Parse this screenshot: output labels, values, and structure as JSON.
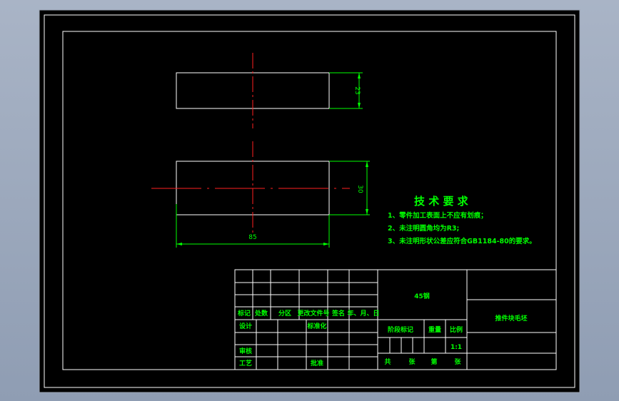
{
  "dimensions": {
    "top_height": "23",
    "front_height": "30",
    "length": "85"
  },
  "tech_requirements": {
    "title": "技 术 要 求",
    "items": [
      "1、零件加工表面上不应有划痕；",
      "2、未注明圆角均为R3;",
      "3、未注明形状公差应符合GB1184-80的要求。"
    ]
  },
  "title_block": {
    "labels": {
      "mark": "标记",
      "count": "处数",
      "zone": "分区",
      "change_doc": "更改文件号",
      "signature": "签名",
      "date": "年、月、日",
      "design": "设计",
      "standardize": "标准化",
      "review": "审核",
      "process": "工艺",
      "approve": "批准",
      "stage_mark": "阶段标记",
      "weight": "重量",
      "scale": "比例"
    },
    "material": "45钢",
    "part_name": "推件块毛坯",
    "scale_value": "1:1",
    "sheet_info": {
      "total": "共",
      "sheet": "张",
      "number": "第",
      "page": "张"
    }
  }
}
